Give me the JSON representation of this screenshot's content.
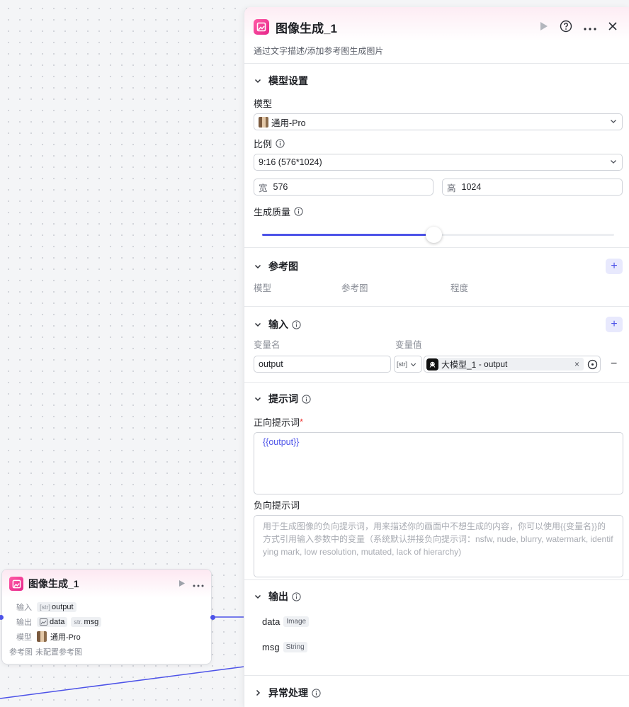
{
  "colors": {
    "accent": "#4d53e8",
    "brand_pink": "#e6258a"
  },
  "node": {
    "title": "图像生成_1",
    "input_label": "输入",
    "input_type": "[str]",
    "input_value": "output",
    "output_label": "输出",
    "output_items": [
      {
        "type_icon": "image-icon",
        "name": "data"
      },
      {
        "type": "str.",
        "name": "msg"
      }
    ],
    "model_label": "模型",
    "model_value": "通用-Pro",
    "ref_label": "参考图",
    "ref_value": "未配置参考图"
  },
  "panel": {
    "title": "图像生成_1",
    "description": "通过文字描述/添加参考图生成图片",
    "model_settings": {
      "title": "模型设置",
      "model_label": "模型",
      "model_value": "通用-Pro",
      "ratio_label": "比例",
      "ratio_value": "9:16 (576*1024)",
      "width_prefix": "宽",
      "width_value": "576",
      "height_prefix": "高",
      "height_value": "1024",
      "quality_label": "生成质量",
      "quality_level": 0.487
    },
    "reference": {
      "title": "参考图",
      "columns": [
        "模型",
        "参考图",
        "程度"
      ]
    },
    "input": {
      "title": "输入",
      "col_name": "变量名",
      "col_value": "变量值",
      "var_name": "output",
      "var_type": "[str]",
      "var_ref_node": "大模型_1",
      "var_ref_sep": " - ",
      "var_ref_field": "output",
      "remove_symbol": "−"
    },
    "prompt": {
      "title": "提示词",
      "positive_label": "正向提示词",
      "required_mark": "*",
      "positive_value": "{{output}}",
      "negative_label": "负向提示词",
      "negative_placeholder": "用于生成图像的负向提示词，用来描述你的画面中不想生成的内容，你可以使用{{变量名}}的方式引用输入参数中的变量（系统默认拼接负向提示词：nsfw, nude, blurry, watermark, identifying mark, low resolution, mutated, lack of hierarchy)"
    },
    "output": {
      "title": "输出",
      "items": [
        {
          "name": "data",
          "type": "Image"
        },
        {
          "name": "msg",
          "type": "String"
        }
      ]
    },
    "error_handling": {
      "title": "异常处理"
    }
  }
}
